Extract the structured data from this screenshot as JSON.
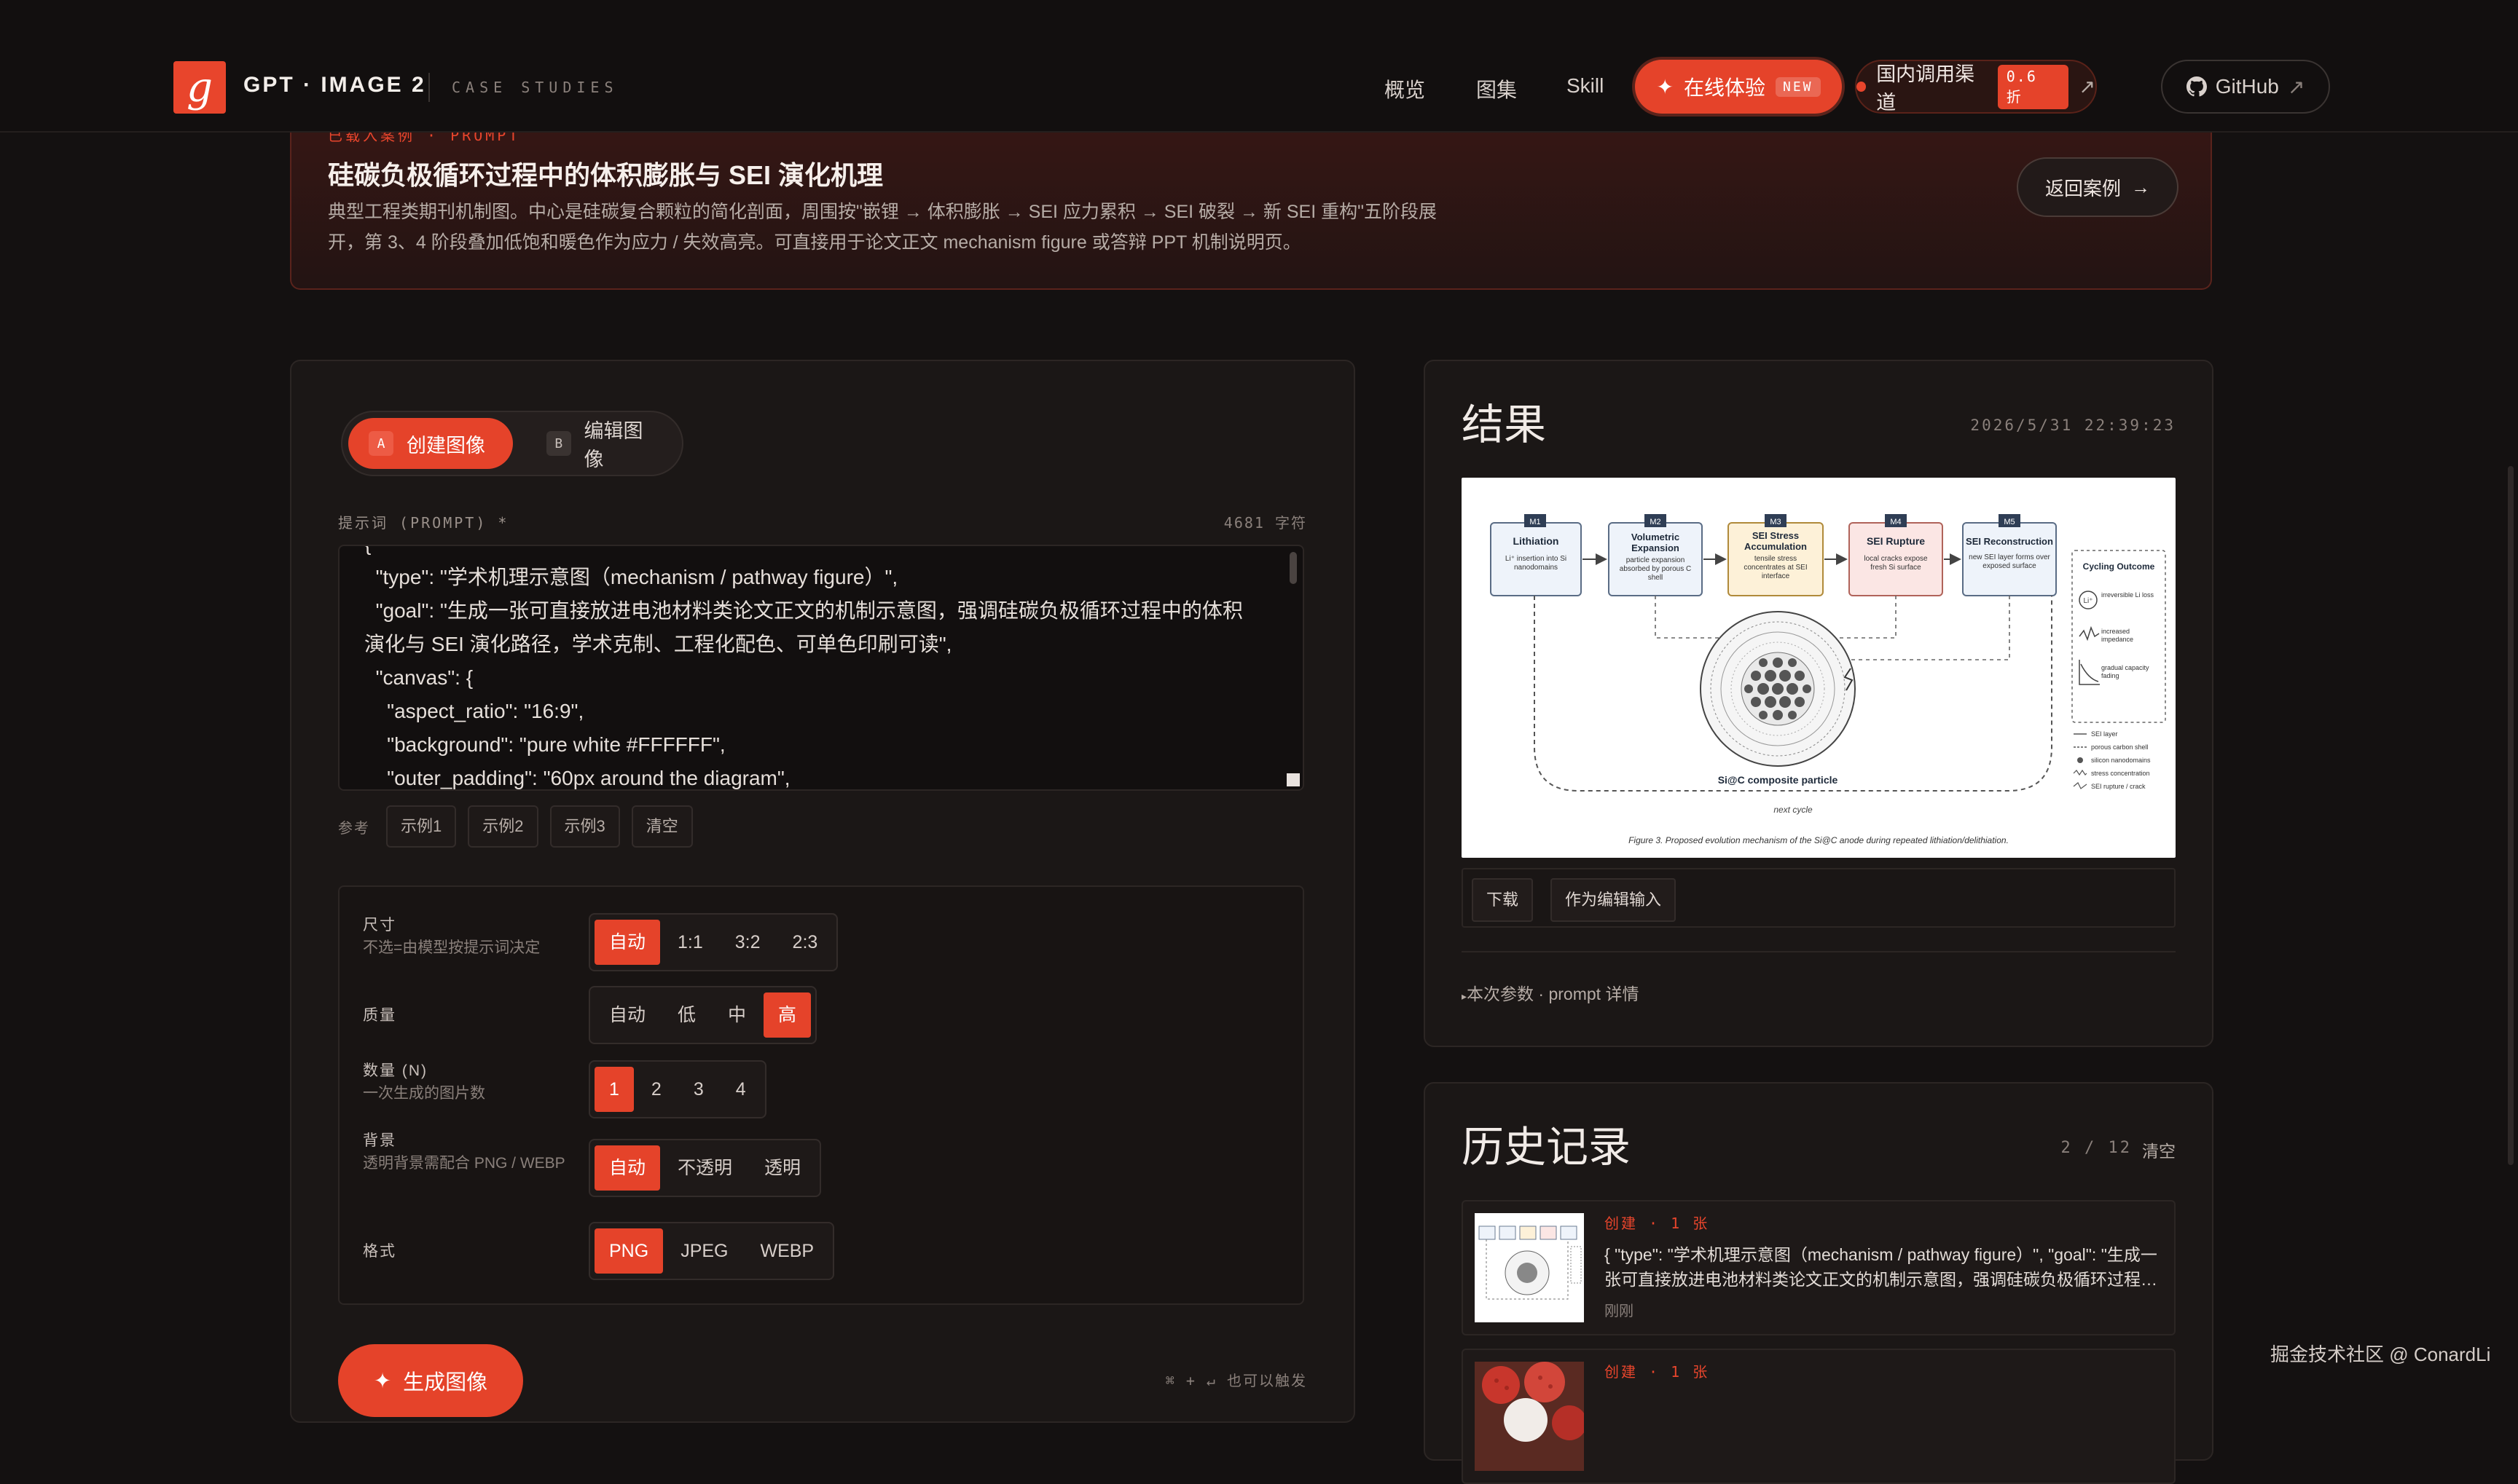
{
  "header": {
    "brand": "GPT · IMAGE 2",
    "brand_sub": "CASE STUDIES",
    "nav": [
      "概览",
      "图集",
      "Skill"
    ],
    "try_label": "在线体验",
    "try_badge": "NEW",
    "channel_label": "国内调用渠道",
    "channel_discount": "0.6 折",
    "github_label": "GitHub",
    "accent": "#e5432a"
  },
  "banner": {
    "tag": "已载入案例 · PROMPT",
    "title": "硅碳负极循环过程中的体积膨胀与 SEI 演化机理",
    "desc": "典型工程类期刊机制图。中心是硅碳复合颗粒的简化剖面，周围按\"嵌锂 → 体积膨胀 → SEI 应力累积 → SEI 破裂 → 新 SEI 重构\"五阶段展开，第 3、4 阶段叠加低饱和暖色作为应力 / 失效高亮。可直接用于论文正文 mechanism figure 或答辩 PPT 机制说明页。",
    "back_label": "返回案例"
  },
  "composer": {
    "mode_create": "创建图像",
    "mode_create_key": "A",
    "mode_edit": "编辑图像",
    "mode_edit_key": "B",
    "prompt_label": "提示词 (PROMPT) *",
    "char_count": "4681 字符",
    "prompt_text": "{\n  \"type\": \"学术机理示意图（mechanism / pathway figure）\",\n  \"goal\": \"生成一张可直接放进电池材料类论文正文的机制示意图，强调硅碳负极循环过程中的体积演化与 SEI 演化路径，学术克制、工程化配色、可单色印刷可读\",\n  \"canvas\": {\n    \"aspect_ratio\": \"16:9\",\n    \"background\": \"pure white #FFFFFF\",\n    \"outer_padding\": \"60px around the diagram\",",
    "ref_label": "参考",
    "refs": [
      "示例1",
      "示例2",
      "示例3",
      "清空"
    ],
    "options": {
      "size": {
        "label": "尺寸",
        "hint": "不选=由模型按提示词决定",
        "items": [
          "自动",
          "1:1",
          "3:2",
          "2:3"
        ],
        "selected": "自动"
      },
      "quality": {
        "label": "质量",
        "items": [
          "自动",
          "低",
          "中",
          "高"
        ],
        "selected": "高"
      },
      "count": {
        "label": "数量 (N)",
        "hint": "一次生成的图片数",
        "items": [
          "1",
          "2",
          "3",
          "4"
        ],
        "selected": "1"
      },
      "background": {
        "label": "背景",
        "hint": "透明背景需配合 PNG / WEBP",
        "items": [
          "自动",
          "不透明",
          "透明"
        ],
        "selected": "自动"
      },
      "format": {
        "label": "格式",
        "items": [
          "PNG",
          "JPEG",
          "WEBP"
        ],
        "selected": "PNG"
      }
    },
    "generate_label": "生成图像",
    "shortcut_hint": "⌘ + ↵ 也可以触发"
  },
  "result": {
    "title": "结果",
    "timestamp": "2026/5/31 22:39:23",
    "download": "下载",
    "as_edit_input": "作为编辑输入",
    "params_link": "本次参数 · prompt 详情",
    "figure": {
      "stages": [
        {
          "tag": "M1",
          "title": "Lithiation",
          "sub": "Li⁺ insertion into Si nanodomains"
        },
        {
          "tag": "M2",
          "title": "Volumetric Expansion",
          "sub": "particle expansion absorbed by porous C shell"
        },
        {
          "tag": "M3",
          "title": "SEI Stress Accumulation",
          "sub": "tensile stress concentrates at SEI interface"
        },
        {
          "tag": "M4",
          "title": "SEI Rupture",
          "sub": "local cracks expose fresh Si surface"
        },
        {
          "tag": "M5",
          "title": "SEI Reconstruction",
          "sub": "new SEI layer forms over exposed surface"
        }
      ],
      "particle_label": "Si@C composite particle",
      "cycle_label": "next cycle",
      "outcome_title": "Cycling Outcome",
      "outcomes": [
        "irreversible Li loss",
        "increased impedance",
        "gradual capacity fading"
      ],
      "legend": [
        "SEI layer",
        "porous carbon shell",
        "silicon nanodomains",
        "stress concentration",
        "SEI rupture / crack"
      ],
      "caption": "Figure 3.  Proposed evolution mechanism of the Si@C anode during repeated lithiation/delithiation."
    }
  },
  "history": {
    "title": "历史记录",
    "count": "2 / 12",
    "clear": "清空",
    "items": [
      {
        "meta": "创建 · 1 张",
        "text": "{ \"type\": \"学术机理示意图（mechanism / pathway figure）\", \"goal\": \"生成一张可直接放进电池材料类论文正文的机制示意图，强调硅碳负极循环过程中的体积演化与 SEI 演化路径，学术克制、工程化配色、可单色印刷可读\"",
        "when": "刚刚"
      },
      {
        "meta": "创建 · 1 张",
        "text": "",
        "when": ""
      }
    ]
  },
  "watermark": "掘金技术社区 @ ConardLi"
}
